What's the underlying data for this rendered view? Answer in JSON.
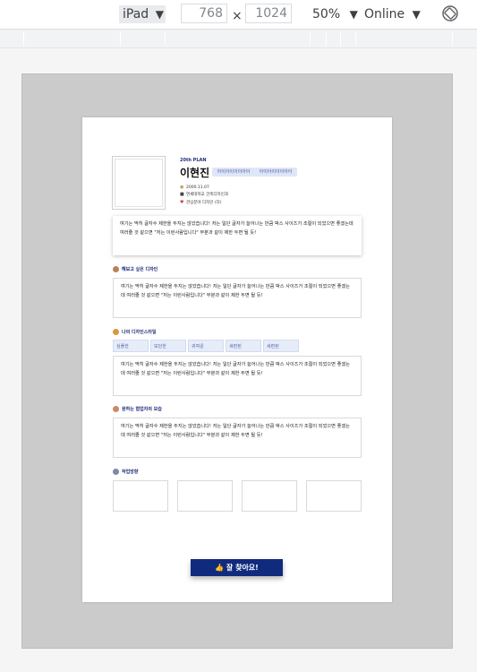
{
  "toolbar": {
    "device": "iPad",
    "width": "768",
    "times": "×",
    "height": "1024",
    "zoom": "50%",
    "network": "Online"
  },
  "resume": {
    "plan_label": "20th PLAN",
    "name": "이현진",
    "tags": [
      "아이아이아이아아",
      "아이아이아이아아"
    ],
    "info": [
      {
        "icon": "calendar-icon",
        "text": "2000.11.07"
      },
      {
        "icon": "school-icon",
        "text": "연세대학교 건축디자인과"
      },
      {
        "icon": "heart-icon",
        "text": "관심분야 디자인 (다)"
      }
    ],
    "intro": "여기는 딱히 글자수 제한을 두지는 않았습니다! 저는 일단 글자가 늘어나는 만큼 박스 사이즈가 조절이 되었으면 좋겠는데 여러줄 것 같으면 \"저는 이런사람입니다\" 부분과 같이 제한 두면 될 듯!",
    "sections": [
      {
        "title": "해보고 싶은 디자인",
        "body": "여기는 딱히 글자수 제한을 두지는 않았습니다! 저는 일단 글자가 늘어나는 만큼 박스 사이즈가 조절이 되었으면 좋겠는데 여러줄 것 같으면 \"저는 이런사람입니다\" 부분과 같이 제한 두면 될 듯!"
      },
      {
        "title": "나의 디자인스타일",
        "body": "여기는 딱히 글자수 제한을 두지는 않았습니다! 저는 일단 글자가 늘어나는 만큼 박스 사이즈가 조절이 되었으면 좋겠는데 여러줄 것 같으면 \"저는 이런사람입니다\" 부분과 같이 제한 두면 될 듯!"
      },
      {
        "title": "원하는 협업자의 모습",
        "body": "여기는 딱히 글자수 제한을 두지는 않았습니다! 저는 일단 글자가 늘어나는 만큼 박스 사이즈가 조절이 되었으면 좋겠는데 여러줄 것 같으면 \"저는 이런사람입니다\" 부분과 같이 제한 두면 될 듯!"
      }
    ],
    "style_chips": [
      "심플한",
      "모던한",
      "귀여운",
      "세련된",
      "세련된"
    ],
    "work_section_title": "작업방향",
    "button_label": "👍 잘 찾아요!"
  }
}
